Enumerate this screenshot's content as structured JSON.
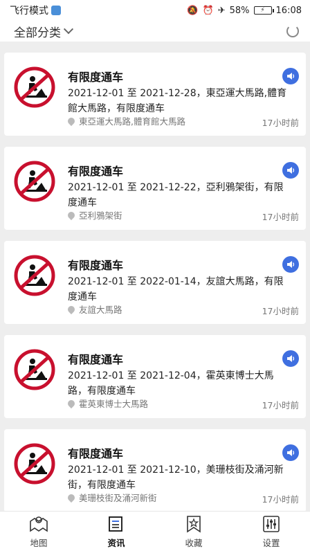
{
  "status_bar": {
    "left_text": "飞行模式",
    "battery_percent": "58%",
    "time": "16:08"
  },
  "filter": {
    "label": "全部分类",
    "refresh_icon": "refresh-icon"
  },
  "items": [
    {
      "title": "有限度通车",
      "desc": "2021-12-01 至 2021-12-28，東亞運大馬路,體育館大馬路，有限度通车",
      "location": "東亞運大馬路,體育館大馬路",
      "time": "17小时前"
    },
    {
      "title": "有限度通车",
      "desc": "2021-12-01 至 2021-12-22，亞利鴉架街，有限度通车",
      "location": "亞利鴉架街",
      "time": "17小时前"
    },
    {
      "title": "有限度通车",
      "desc": "2021-12-01 至 2022-01-14，友誼大馬路，有限度通车",
      "location": "友誼大馬路",
      "time": "17小时前"
    },
    {
      "title": "有限度通车",
      "desc": "2021-12-01 至 2021-12-04，霍英東博士大馬路，有限度通车",
      "location": "霍英東博士大馬路",
      "time": "17小时前"
    },
    {
      "title": "有限度通车",
      "desc": "2021-12-01 至 2021-12-10，美珊枝街及涌河新街，有限度通车",
      "location": "美珊枝街及涌河新街",
      "time": "17小时前"
    }
  ],
  "nav": {
    "map": "地图",
    "news": "资讯",
    "favorites": "收藏",
    "settings": "设置"
  },
  "colors": {
    "accent": "#3f6fe0",
    "sign_red": "#c8102e"
  }
}
